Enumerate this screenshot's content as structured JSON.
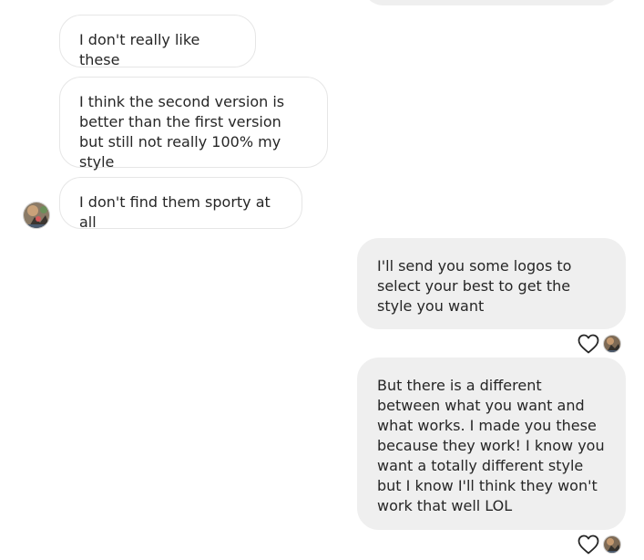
{
  "conversation": {
    "incoming_messages": [
      {
        "text": "I don't really like these"
      },
      {
        "text": "I think the second version is better than the first version but still not really 100% my style"
      },
      {
        "text": "I don't find them sporty at all"
      }
    ],
    "outgoing_messages": [
      {
        "text": "I'll send you some logos to select your best to get the style you want"
      },
      {
        "text": "But there is a different between what you want and what works. I made you these because they work! I know you want a totally different style but I know I'll think they won't work that well LOL"
      }
    ]
  },
  "icons": {
    "like": "heart-outline-icon",
    "avatar": "contact-avatar"
  },
  "colors": {
    "background": "#ffffff",
    "incoming_bubble": "#ffffff",
    "incoming_border": "#e6e6e6",
    "outgoing_bubble": "#efefef",
    "text": "#262626"
  }
}
